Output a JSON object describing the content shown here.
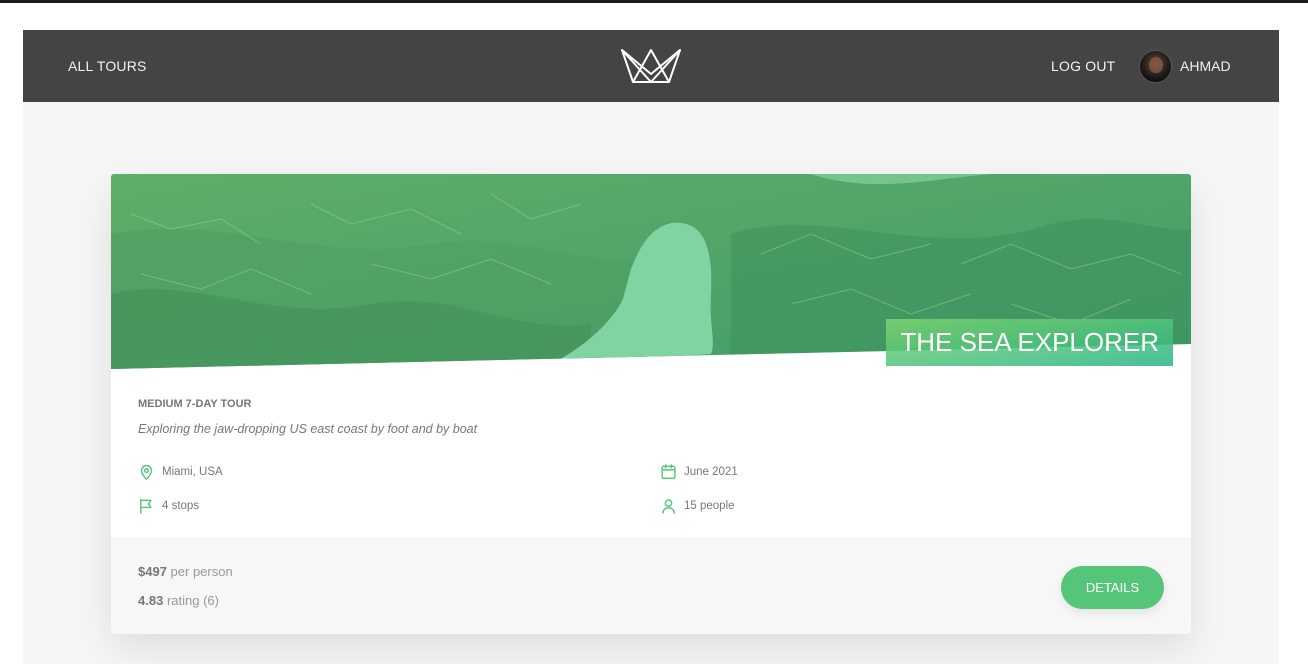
{
  "nav": {
    "all_tours": "All tours",
    "logout": "Log out",
    "user_name": "Ahmad"
  },
  "tour": {
    "name": "The Sea Explorer",
    "difficulty_duration": "medium 7-day tour",
    "summary": "Exploring the jaw-dropping US east coast by foot and by boat",
    "details": {
      "location": "Miami, USA",
      "date": "June 2021",
      "stops": "4 stops",
      "participants": "15 people"
    },
    "price_value": "$497",
    "price_suffix": "per person",
    "rating_value": "4.83",
    "rating_suffix": "rating (6)"
  },
  "buttons": {
    "details": "Details"
  },
  "icons": {
    "logo": "crown-logo-icon",
    "location": "map-pin-icon",
    "date": "calendar-icon",
    "stops": "flag-icon",
    "participants": "user-icon"
  },
  "colors": {
    "accent": "#55c57a",
    "header_bg": "#444444",
    "page_bg": "#f6f6f6"
  }
}
